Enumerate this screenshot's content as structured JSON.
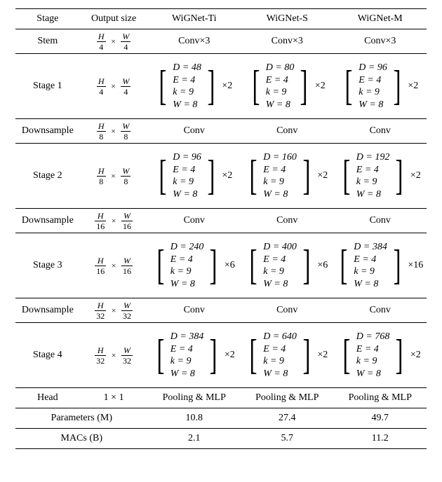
{
  "chart_data": {
    "type": "table",
    "title": "",
    "columns": [
      "Stage",
      "Output size",
      "WiGNet-Ti",
      "WiGNet-S",
      "WiGNet-M"
    ],
    "rows": [
      {
        "stage": "Stem",
        "output": "H/4 × W/4",
        "ti": "Conv×3",
        "s": "Conv×3",
        "m": "Conv×3"
      },
      {
        "stage": "Stage 1",
        "output": "H/4 × W/4",
        "ti": {
          "D": 48,
          "E": 4,
          "k": 9,
          "W": 8,
          "repeat": 2
        },
        "s": {
          "D": 80,
          "E": 4,
          "k": 9,
          "W": 8,
          "repeat": 2
        },
        "m": {
          "D": 96,
          "E": 4,
          "k": 9,
          "W": 8,
          "repeat": 2
        }
      },
      {
        "stage": "Downsample",
        "output": "H/8 × W/8",
        "ti": "Conv",
        "s": "Conv",
        "m": "Conv"
      },
      {
        "stage": "Stage 2",
        "output": "H/8 × W/8",
        "ti": {
          "D": 96,
          "E": 4,
          "k": 9,
          "W": 8,
          "repeat": 2
        },
        "s": {
          "D": 160,
          "E": 4,
          "k": 9,
          "W": 8,
          "repeat": 2
        },
        "m": {
          "D": 192,
          "E": 4,
          "k": 9,
          "W": 8,
          "repeat": 2
        }
      },
      {
        "stage": "Downsample",
        "output": "H/16 × W/16",
        "ti": "Conv",
        "s": "Conv",
        "m": "Conv"
      },
      {
        "stage": "Stage 3",
        "output": "H/16 × W/16",
        "ti": {
          "D": 240,
          "E": 4,
          "k": 9,
          "W": 8,
          "repeat": 6
        },
        "s": {
          "D": 400,
          "E": 4,
          "k": 9,
          "W": 8,
          "repeat": 6
        },
        "m": {
          "D": 384,
          "E": 4,
          "k": 9,
          "W": 8,
          "repeat": 16
        }
      },
      {
        "stage": "Downsample",
        "output": "H/32 × W/32",
        "ti": "Conv",
        "s": "Conv",
        "m": "Conv"
      },
      {
        "stage": "Stage 4",
        "output": "H/32 × W/32",
        "ti": {
          "D": 384,
          "E": 4,
          "k": 9,
          "W": 8,
          "repeat": 2
        },
        "s": {
          "D": 640,
          "E": 4,
          "k": 9,
          "W": 8,
          "repeat": 2
        },
        "m": {
          "D": 768,
          "E": 4,
          "k": 9,
          "W": 8,
          "repeat": 2
        }
      },
      {
        "stage": "Head",
        "output": "1 × 1",
        "ti": "Pooling & MLP",
        "s": "Pooling & MLP",
        "m": "Pooling & MLP"
      },
      {
        "stage": "Parameters (M)",
        "ti": 10.8,
        "s": 27.4,
        "m": 49.7
      },
      {
        "stage": "MACs (B)",
        "ti": 2.1,
        "s": 5.7,
        "m": 11.2
      }
    ]
  },
  "hdr": {
    "c0": "Stage",
    "c1": "Output size",
    "c2": "WiGNet-Ti",
    "c3": "WiGNet-S",
    "c4": "WiGNet-M"
  },
  "stem": {
    "stage": "Stem",
    "out_num_h": "H",
    "out_num_w": "W",
    "out_den": "4",
    "val": "Conv×3"
  },
  "s1": {
    "stage": "Stage 1",
    "out_num_h": "H",
    "out_num_w": "W",
    "out_den": "4",
    "ti": {
      "d": "D = 48",
      "e": "E = 4",
      "k": "k = 9",
      "w": "W = 8",
      "r": "×2"
    },
    "s": {
      "d": "D = 80",
      "e": "E = 4",
      "k": "k = 9",
      "w": "W = 8",
      "r": "×2"
    },
    "m": {
      "d": "D = 96",
      "e": "E = 4",
      "k": "k = 9",
      "w": "W = 8",
      "r": "×2"
    }
  },
  "d1": {
    "stage": "Downsample",
    "out_num_h": "H",
    "out_num_w": "W",
    "out_den": "8",
    "val": "Conv"
  },
  "s2": {
    "stage": "Stage 2",
    "out_num_h": "H",
    "out_num_w": "W",
    "out_den": "8",
    "ti": {
      "d": "D = 96",
      "e": "E = 4",
      "k": "k = 9",
      "w": "W = 8",
      "r": "×2"
    },
    "s": {
      "d": "D = 160",
      "e": "E = 4",
      "k": "k = 9",
      "w": "W = 8",
      "r": "×2"
    },
    "m": {
      "d": "D = 192",
      "e": "E = 4",
      "k": "k = 9",
      "w": "W = 8",
      "r": "×2"
    }
  },
  "d2": {
    "stage": "Downsample",
    "out_num_h": "H",
    "out_num_w": "W",
    "out_den": "16",
    "val": "Conv"
  },
  "s3": {
    "stage": "Stage 3",
    "out_num_h": "H",
    "out_num_w": "W",
    "out_den": "16",
    "ti": {
      "d": "D = 240",
      "e": "E = 4",
      "k": "k = 9",
      "w": "W = 8",
      "r": "×6"
    },
    "s": {
      "d": "D = 400",
      "e": "E = 4",
      "k": "k = 9",
      "w": "W = 8",
      "r": "×6"
    },
    "m": {
      "d": "D = 384",
      "e": "E = 4",
      "k": "k = 9",
      "w": "W = 8",
      "r": "×16"
    }
  },
  "d3": {
    "stage": "Downsample",
    "out_num_h": "H",
    "out_num_w": "W",
    "out_den": "32",
    "val": "Conv"
  },
  "s4": {
    "stage": "Stage 4",
    "out_num_h": "H",
    "out_num_w": "W",
    "out_den": "32",
    "ti": {
      "d": "D = 384",
      "e": "E = 4",
      "k": "k = 9",
      "w": "W = 8",
      "r": "×2"
    },
    "s": {
      "d": "D = 640",
      "e": "E = 4",
      "k": "k = 9",
      "w": "W = 8",
      "r": "×2"
    },
    "m": {
      "d": "D = 768",
      "e": "E = 4",
      "k": "k = 9",
      "w": "W = 8",
      "r": "×2"
    }
  },
  "head": {
    "stage": "Head",
    "out": "1 × 1",
    "val": "Pooling & MLP"
  },
  "params": {
    "label": "Parameters (M)",
    "ti": "10.8",
    "s": "27.4",
    "m": "49.7"
  },
  "macs": {
    "label": "MACs (B)",
    "ti": "2.1",
    "s": "5.7",
    "m": "11.2"
  }
}
